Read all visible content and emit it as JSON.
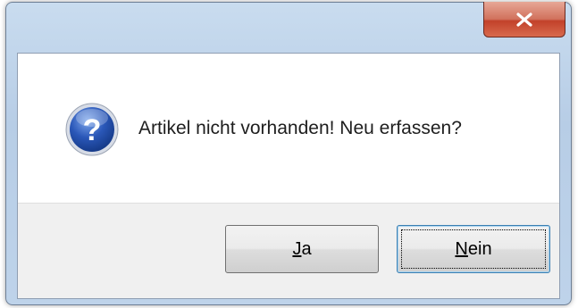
{
  "dialog": {
    "message": "Artikel nicht vorhanden! Neu erfassen?",
    "icon": "question-icon"
  },
  "titlebar": {
    "close_icon": "close-icon"
  },
  "buttons": {
    "yes": {
      "mnemonic": "J",
      "rest": "a"
    },
    "no": {
      "mnemonic": "N",
      "rest": "ein"
    }
  },
  "colors": {
    "icon_blue": "#2a57b8",
    "close_red": "#c2412a",
    "button_area": "#f0f0f0"
  }
}
